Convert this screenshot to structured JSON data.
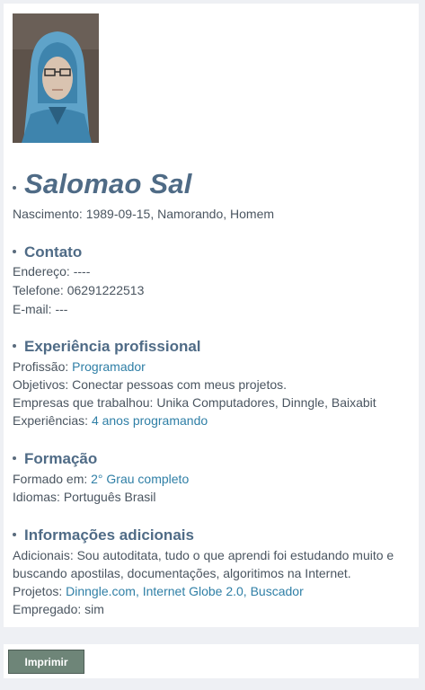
{
  "profile": {
    "name": "Salomao Sal",
    "birth_label": "Nascimento:",
    "birth_value": "1989-09-15, Namorando, Homem"
  },
  "contact": {
    "title": "Contato",
    "address_label": "Endereço:",
    "address_value": "----",
    "phone_label": "Telefone:",
    "phone_value": "06291222513",
    "email_label": "E-mail:",
    "email_value": "---"
  },
  "experience": {
    "title": "Experiência profissional",
    "profession_label": "Profissão:",
    "profession_value": "Programador",
    "objectives_label": "Objetivos:",
    "objectives_value": "Conectar pessoas com meus projetos.",
    "companies_label": "Empresas que trabalhou:",
    "companies_value": "Unika Computadores, Dinngle, Baixabit",
    "experiences_label": "Experiências:",
    "experiences_value": "4 anos programando"
  },
  "education": {
    "title": "Formação",
    "graduated_label": "Formado em:",
    "graduated_value": "2° Grau completo",
    "languages_label": "Idiomas:",
    "languages_value": "Português Brasil"
  },
  "additional": {
    "title": "Informações adicionais",
    "extra_label": "Adicionais:",
    "extra_line1": "Sou autoditata, tudo o que aprendi foi estudando muito e",
    "extra_line2": "buscando apostilas, documentações, algoritimos na Internet.",
    "projects_label": "Projetos:",
    "projects_value": "Dinngle.com, Internet Globe 2.0, Buscador",
    "employed_label": "Empregado:",
    "employed_value": "sim"
  },
  "footer": {
    "print_label": "Imprimir"
  },
  "colors": {
    "heading": "#4f6b86",
    "link": "#2f7fa6",
    "button": "#6e8578"
  }
}
